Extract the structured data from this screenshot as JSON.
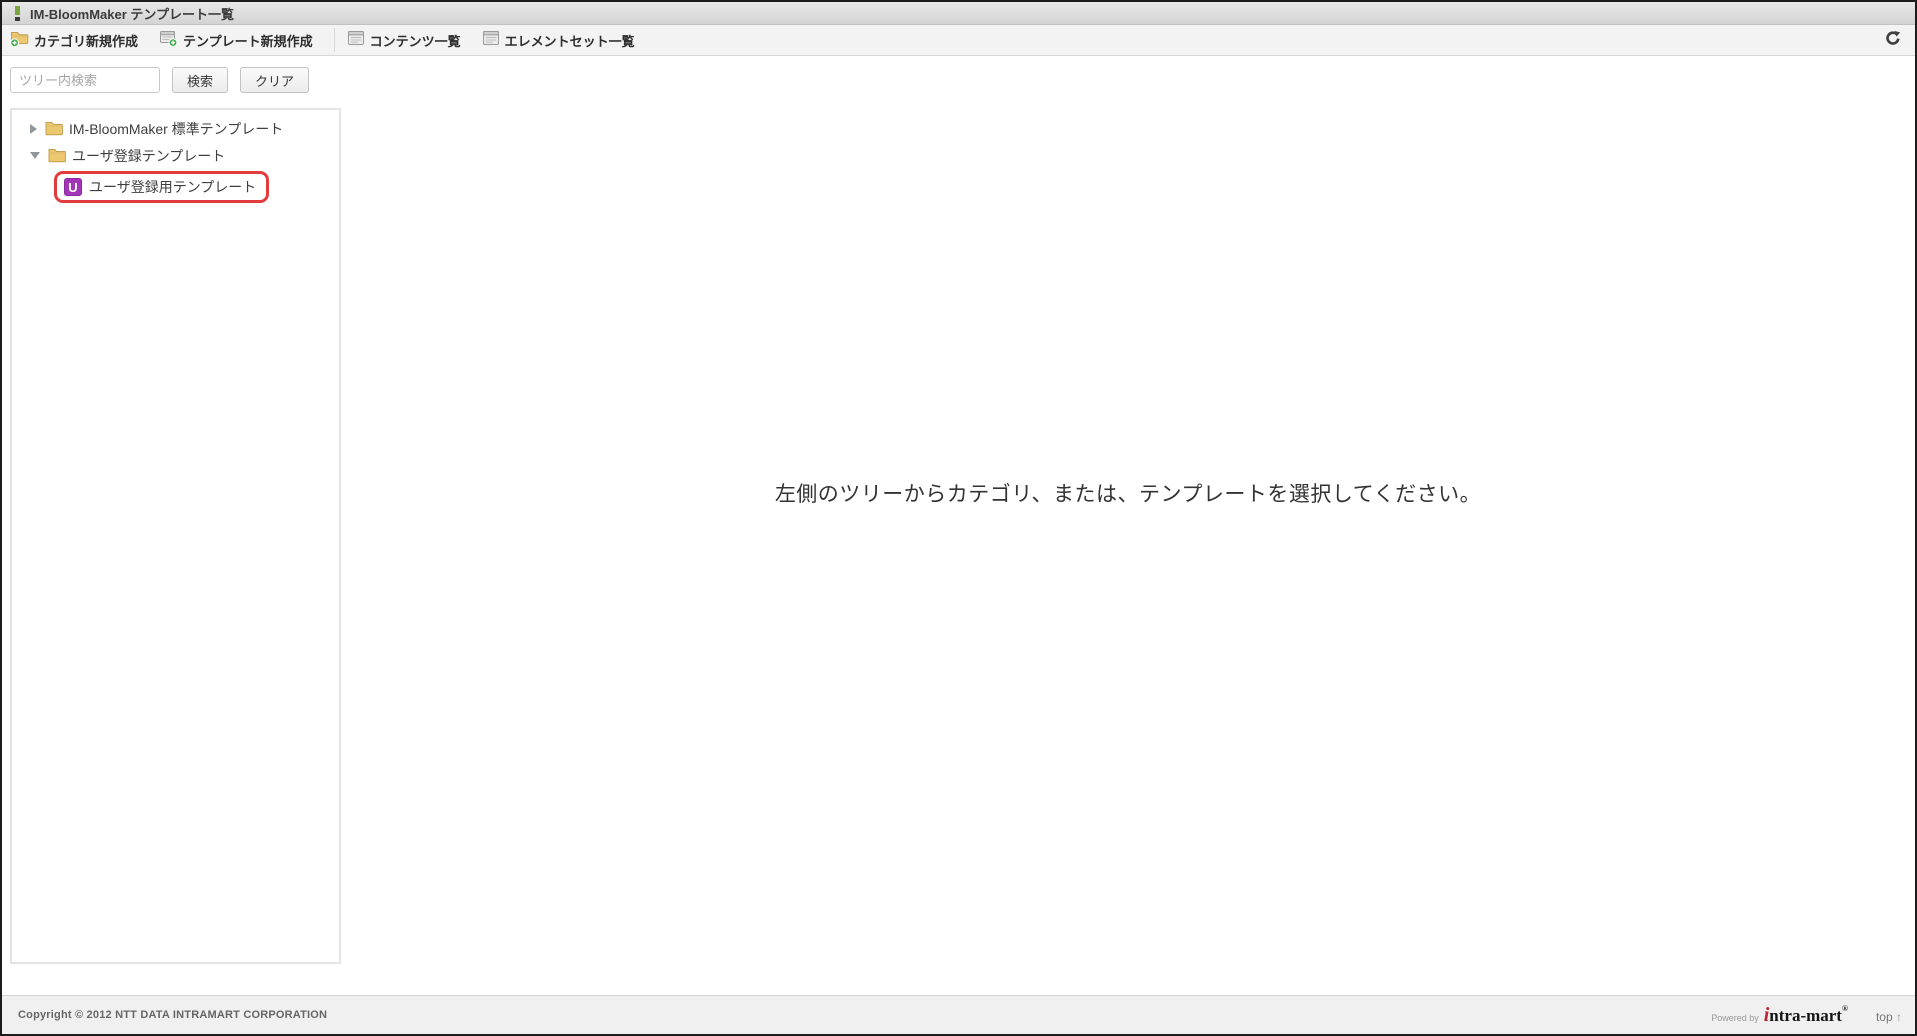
{
  "titlebar": {
    "title": "IM-BloomMaker テンプレート一覧"
  },
  "toolbar": {
    "items": [
      {
        "label": "カテゴリ新規作成",
        "icon": "category-new-icon"
      },
      {
        "label": "テンプレート新規作成",
        "icon": "template-new-icon"
      },
      {
        "label": "コンテンツ一覧",
        "icon": "contents-list-icon"
      },
      {
        "label": "エレメントセット一覧",
        "icon": "element-set-list-icon"
      }
    ]
  },
  "search": {
    "placeholder": "ツリー内検索",
    "search_button": "検索",
    "clear_button": "クリア"
  },
  "tree": {
    "items": [
      {
        "label": "IM-BloomMaker 標準テンプレート",
        "state": "collapsed",
        "icon": "folder-icon"
      },
      {
        "label": "ユーザ登録テンプレート",
        "state": "expanded",
        "icon": "folder-icon"
      },
      {
        "label": "ユーザ登録用テンプレート",
        "badge": "U",
        "icon": "template-badge-icon",
        "highlighted": true
      }
    ]
  },
  "main": {
    "message": "左側のツリーからカテゴリ、または、テンプレートを選択してください。"
  },
  "footer": {
    "copyright": "Copyright © 2012 NTT DATA INTRAMART CORPORATION",
    "powered_by": "Powered by",
    "logo_i": "i",
    "logo_rest": "ntra-mart",
    "logo_mark": "®",
    "top_label": "top",
    "top_arrow": "↑"
  },
  "colors": {
    "badge_purple": "#a335b9",
    "highlight_red": "#e23b3b",
    "folder_tan": "#ecc971",
    "plus_green": "#3fae49",
    "logo_red": "#c41f2e"
  }
}
